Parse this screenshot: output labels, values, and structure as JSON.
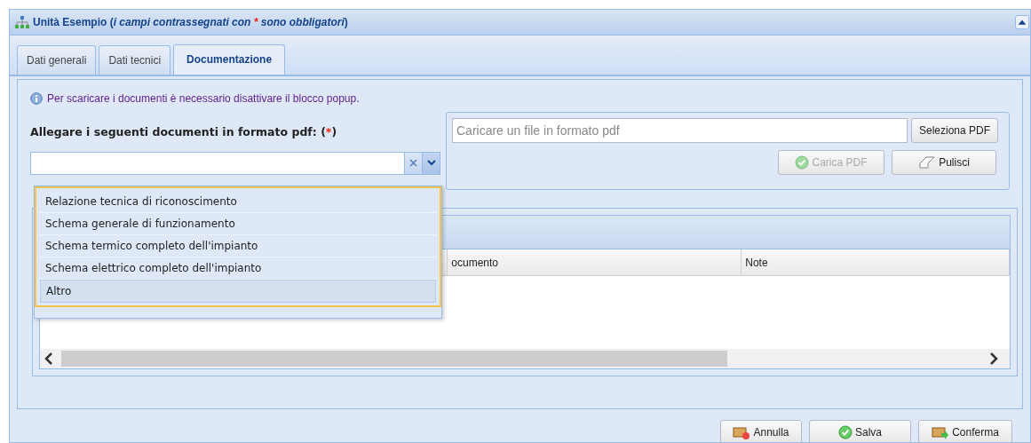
{
  "window": {
    "title": "Unità Esempio",
    "subtitle_open": " (",
    "subtitle": "i campi contrassegnati con ",
    "required_mark": "*",
    "subtitle_end": " sono obbligatori",
    "subtitle_close": ")"
  },
  "tabs": [
    {
      "label": "Dati generali",
      "selected": false
    },
    {
      "label": "Dati tecnici",
      "selected": false
    },
    {
      "label": "Documentazione",
      "selected": true
    }
  ],
  "info": "Per scaricare i documenti è necessario disattivare il blocco popup.",
  "documents": {
    "label": "Allegare i seguenti documenti in formato pdf: (",
    "required_mark": "*",
    "label_end": ")",
    "expanded": true,
    "options": [
      {
        "label": "Relazione tecnica di riconoscimento",
        "highlighted": false
      },
      {
        "label": "Schema generale di funzionamento",
        "highlighted": false
      },
      {
        "label": "Schema termico completo dell'impianto",
        "highlighted": false
      },
      {
        "label": "Schema elettrico completo dell'impianto",
        "highlighted": false
      },
      {
        "label": "Altro",
        "highlighted": true
      }
    ]
  },
  "upload": {
    "placeholder": "Caricare un file in formato pdf",
    "select_button": "Seleziona PDF",
    "buttons": [
      {
        "label": "Carica PDF",
        "kind": "upload",
        "disabled": true
      },
      {
        "label": "Pulisci",
        "kind": "clear",
        "disabled": false
      }
    ]
  },
  "table": {
    "columns": [
      "",
      "ocumento",
      "Note"
    ]
  },
  "footer_buttons": [
    {
      "label": "Annulla",
      "kind": "cancel"
    },
    {
      "label": "Salva",
      "kind": "save"
    },
    {
      "label": "Conferma",
      "kind": "confirm"
    }
  ]
}
